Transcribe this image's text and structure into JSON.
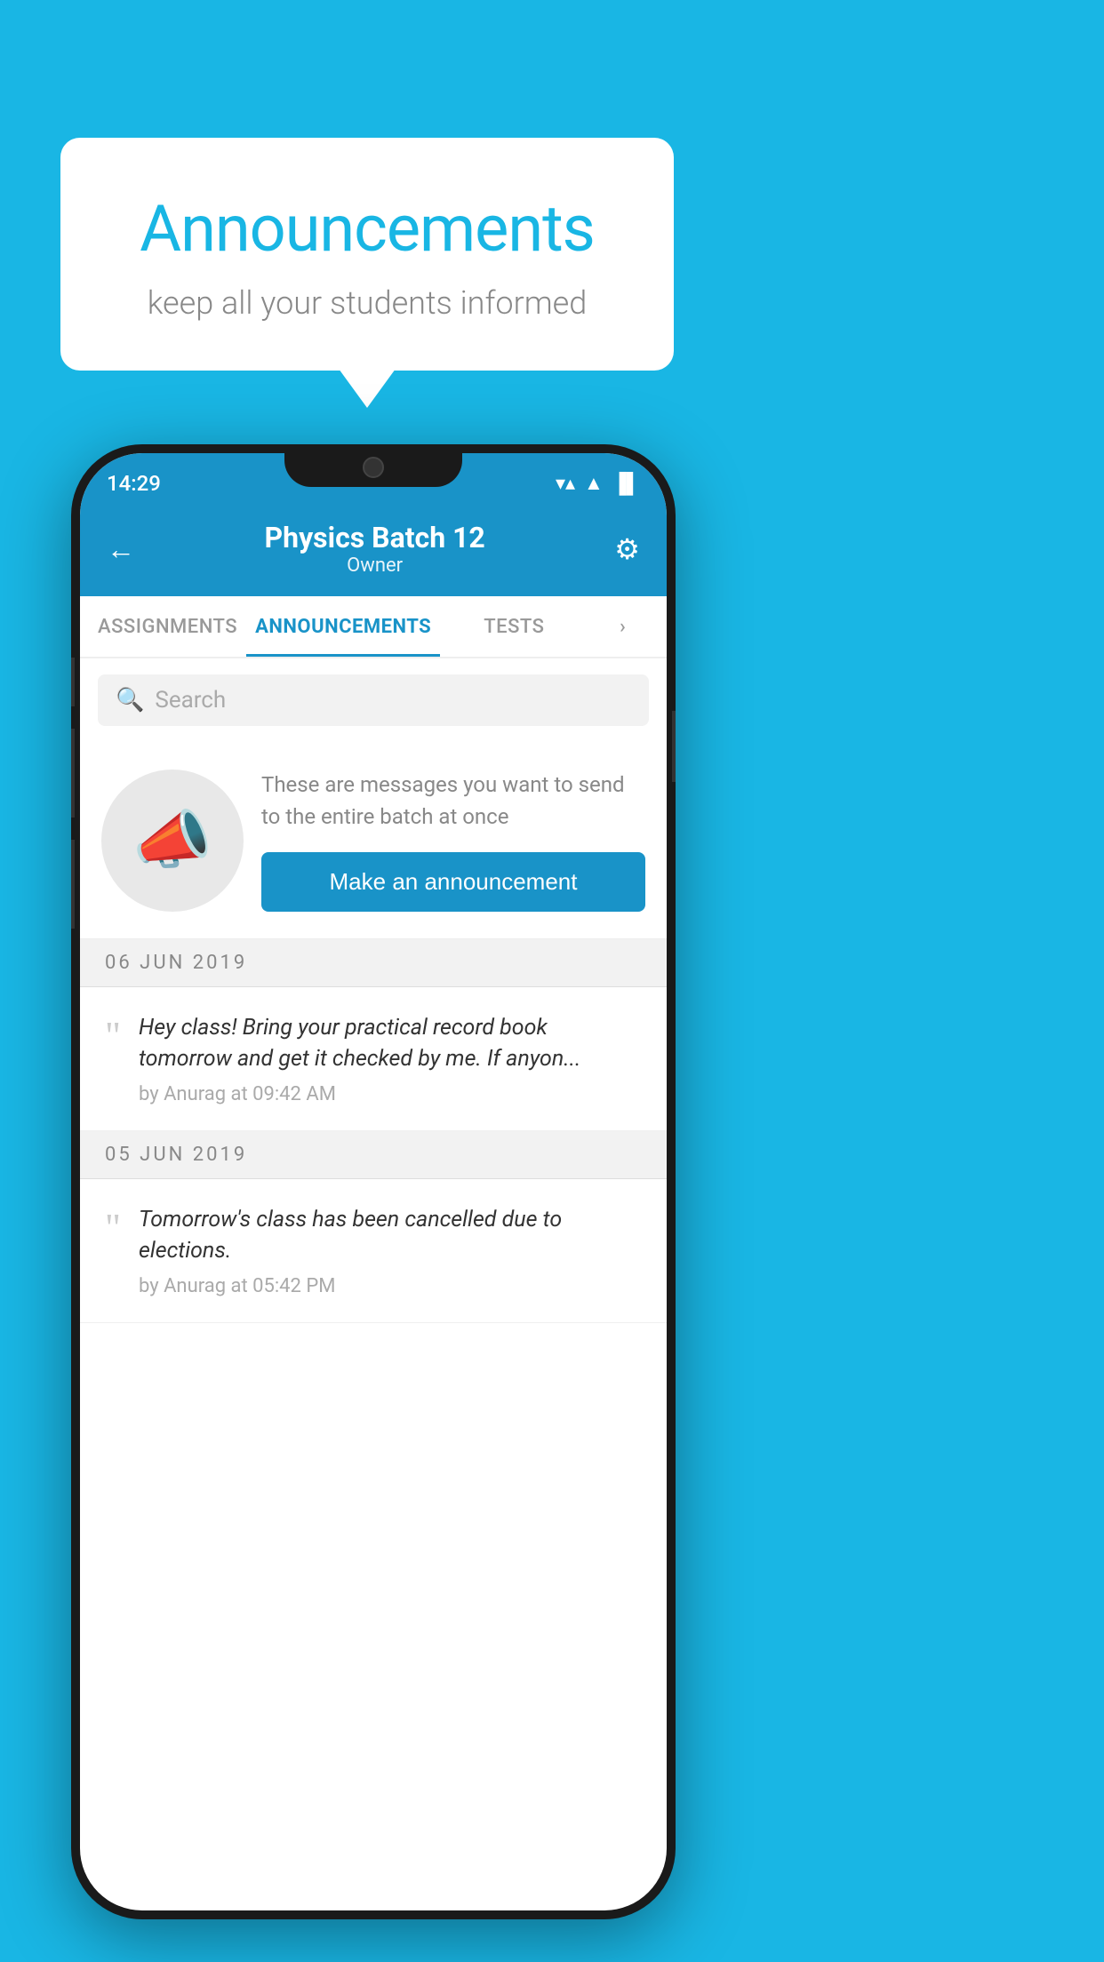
{
  "background_color": "#19B6E4",
  "speech_bubble": {
    "title": "Announcements",
    "subtitle": "keep all your students informed"
  },
  "phone": {
    "status_bar": {
      "time": "14:29",
      "wifi": "▼",
      "signal": "▲",
      "battery": "▐"
    },
    "header": {
      "back_label": "←",
      "title": "Physics Batch 12",
      "subtitle": "Owner",
      "gear_label": "⚙"
    },
    "tabs": [
      {
        "label": "ASSIGNMENTS",
        "active": false
      },
      {
        "label": "ANNOUNCEMENTS",
        "active": true
      },
      {
        "label": "TESTS",
        "active": false
      },
      {
        "label": "",
        "active": false,
        "partial": true
      }
    ],
    "search": {
      "placeholder": "Search"
    },
    "promo": {
      "description": "These are messages you want to send to the entire batch at once",
      "button_label": "Make an announcement"
    },
    "announcements": [
      {
        "date": "06  JUN  2019",
        "text": "Hey class! Bring your practical record book tomorrow and get it checked by me. If anyon...",
        "meta": "by Anurag at 09:42 AM"
      },
      {
        "date": "05  JUN  2019",
        "text": "Tomorrow's class has been cancelled due to elections.",
        "meta": "by Anurag at 05:42 PM"
      }
    ]
  }
}
